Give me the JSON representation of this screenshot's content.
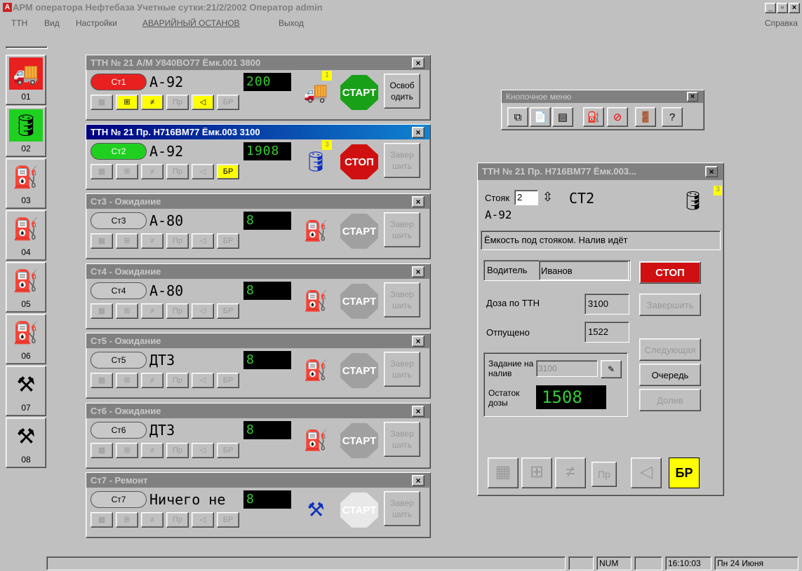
{
  "titlebar": {
    "title": "АРМ оператора   Нефтебаза   Учетные сутки:21/2/2002   Оператор  admin",
    "logo": "A"
  },
  "menu": {
    "items": [
      "ТТН",
      "Вид",
      "Настройки",
      "АВАРИЙНЫЙ ОСТАНОВ",
      "Выход"
    ],
    "help": "Справка"
  },
  "sidebar": [
    {
      "label": "01",
      "icon": "tanker-truck-icon"
    },
    {
      "label": "02",
      "icon": "tanker-wagon-icon"
    },
    {
      "label": "03",
      "icon": "pump-icon"
    },
    {
      "label": "04",
      "icon": "pump-icon"
    },
    {
      "label": "05",
      "icon": "pump-icon"
    },
    {
      "label": "06",
      "icon": "pump-icon"
    },
    {
      "label": "07",
      "icon": "repair-icon"
    },
    {
      "label": "08",
      "icon": "repair-icon"
    }
  ],
  "stations": [
    {
      "title": "ТТН № 21 А/М У840ВО77  Ёмк.001  3800",
      "pill": "Ст1",
      "fuel": "А-92",
      "lcd": "200",
      "slot": "1",
      "action": "СТАРТ",
      "side": "Освоб одить",
      "active": false,
      "color": "red"
    },
    {
      "title": "ТТН № 21 Пр. Н716ВМ77  Ёмк.003 3100",
      "pill": "Ст2",
      "fuel": "А-92",
      "lcd": "1908",
      "slot": "3",
      "action": "СТОП",
      "side": "Завер шить",
      "active": true,
      "color": "green"
    },
    {
      "title": "Ст3 - Ожидание",
      "pill": "Ст3",
      "fuel": "А-80",
      "lcd": "8",
      "slot": "",
      "action": "СТАРТ",
      "side": "Завер шить",
      "active": false,
      "color": "gray"
    },
    {
      "title": "Ст4 - Ожидание",
      "pill": "Ст4",
      "fuel": "А-80",
      "lcd": "8",
      "slot": "",
      "action": "СТАРТ",
      "side": "Завер шить",
      "active": false,
      "color": "gray"
    },
    {
      "title": "Ст5 - Ожидание",
      "pill": "Ст5",
      "fuel": "ДТЗ",
      "lcd": "8",
      "slot": "",
      "action": "СТАРТ",
      "side": "Завер шить",
      "active": false,
      "color": "gray"
    },
    {
      "title": "Ст6 - Ожидание",
      "pill": "Ст6",
      "fuel": "ДТЗ",
      "lcd": "8",
      "slot": "",
      "action": "СТАРТ",
      "side": "Завер шить",
      "active": false,
      "color": "gray"
    },
    {
      "title": "Ст7 - Ремонт",
      "pill": "Ст7",
      "fuel": "Ничего не",
      "lcd": "8",
      "slot": "",
      "action": "СТАРТ",
      "side": "Завер шить",
      "active": false,
      "color": "gray"
    }
  ],
  "small_buttons": [
    "Пр",
    "БР"
  ],
  "button_menu": {
    "title": "Кнопочное меню"
  },
  "detail": {
    "title": "ТТН № 21 Пр. Н716ВМ77  Ёмк.003...",
    "stand_label": "Стояк",
    "stand_value": "2",
    "stand_name": "СТ2",
    "fuel": "А-92",
    "slot": "3",
    "status": "Ёмкость под стояком. Налив идёт",
    "driver_label": "Водитель",
    "driver": "Иванов",
    "dose_label": "Доза по ТТН",
    "dose": "3100",
    "released_label": "Отпущено",
    "released": "1522",
    "task_label": "Задание на налив",
    "task_value": "3100",
    "rest_label": "Остаток дозы",
    "rest_lcd": "1508",
    "btn_stop": "СТОП",
    "btn_finish": "Завершить",
    "btn_next": "Следующая",
    "btn_queue": "Очередь",
    "btn_refill": "Долив",
    "bottom_pr": "Пр",
    "bottom_br": "БР"
  },
  "statusbar": {
    "num": "NUM",
    "time": "16:10:03",
    "date": "Пн 24 Июня"
  },
  "colors": {
    "red": "#e82020",
    "green": "#20d020",
    "active_caption": "#000080",
    "yellow": "#ffff00"
  }
}
